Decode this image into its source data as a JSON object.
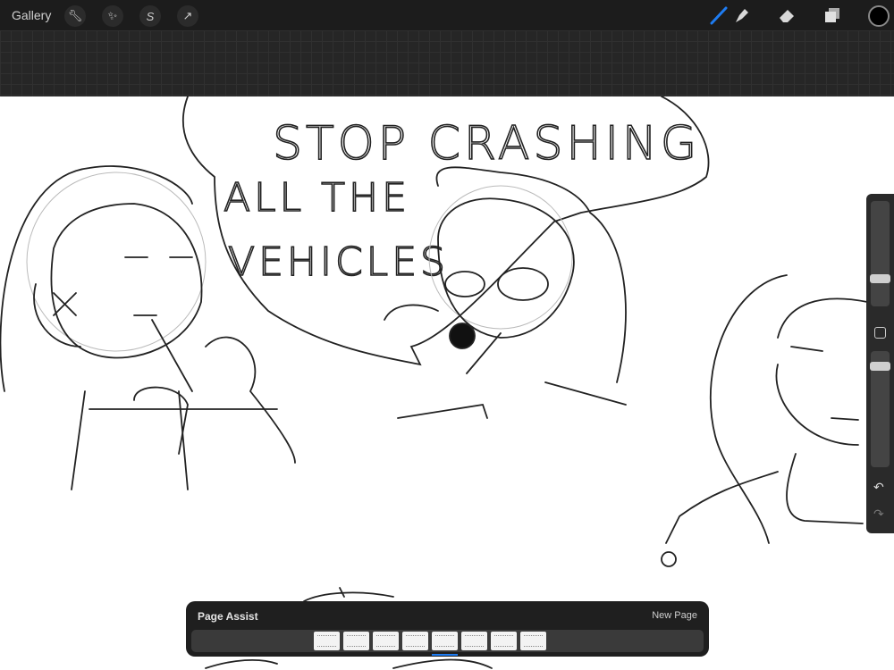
{
  "topbar": {
    "gallery_label": "Gallery",
    "left_tools": [
      "wrench-icon",
      "magic-wand-icon",
      "selection-icon",
      "transform-arrow-icon"
    ],
    "right_tools": [
      "brush-icon",
      "smudge-icon",
      "eraser-icon",
      "layers-icon"
    ],
    "active_tool": "brush",
    "accent_color": "#1e7cf2",
    "current_color": "#000000"
  },
  "canvas": {
    "speech_line1": "STOP CRASHING",
    "speech_line2": "ALL THE",
    "speech_line3": "VEHICLES"
  },
  "sidebar": {
    "brush_size_fraction": 0.75,
    "opacity_fraction": 0.9
  },
  "page_assist": {
    "title": "Page Assist",
    "new_page_label": "New Page",
    "page_count": 8,
    "selected_page": 5
  }
}
